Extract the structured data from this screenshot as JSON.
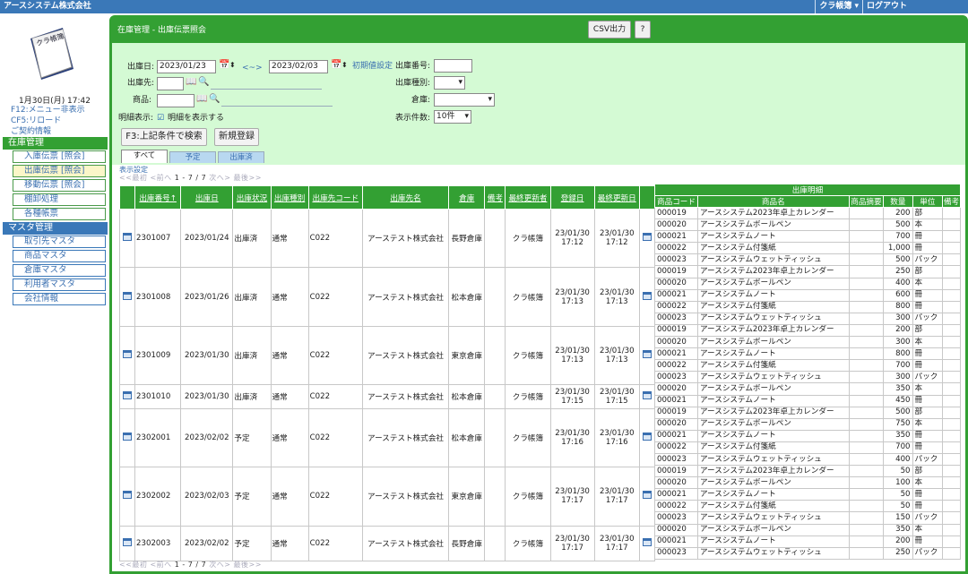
{
  "topbar": {
    "company": "アースシステム株式会社",
    "user_menu": "クラ帳簿 ▾",
    "logout": "ログアウト"
  },
  "sidebar": {
    "logo_text": "クラ帳簿",
    "date": "1月30日(月) 17:42",
    "links": [
      "F12:メニュー非表示",
      "CF5:リロード",
      "ご契約情報"
    ],
    "sections": [
      {
        "title": "在庫管理",
        "color": "#33a033",
        "items": [
          "入庫伝票 [照会]",
          "出庫伝票 [照会]",
          "移動伝票 [照会]",
          "棚卸処理",
          "各種帳票"
        ]
      },
      {
        "title": "マスタ管理",
        "color": "#3a78b8",
        "items": [
          "取引先マスタ",
          "商品マスタ",
          "倉庫マスタ",
          "利用者マスタ",
          "会社情報"
        ]
      }
    ]
  },
  "header": {
    "title": "在庫管理 - 出庫伝票照会",
    "csv_button": "CSV出力",
    "help_button": "?"
  },
  "search": {
    "ship_date_label": "出庫日:",
    "date_from": "2023/01/23",
    "range_sep": "<~>",
    "date_to": "2023/02/03",
    "reset_link": "初期値設定",
    "dest_label": "出庫先:",
    "product_label": "商品:",
    "detail_label": "明細表示:",
    "detail_checkbox": "明細を表示する",
    "ship_no_label": "出庫番号:",
    "ship_type_label": "出庫種別:",
    "warehouse_label": "倉庫:",
    "count_label": "表示件数:",
    "count_value": "10件",
    "search_button": "F3:上記条件で検索",
    "new_button": "新規登録"
  },
  "tabs": [
    "すべて",
    "予定",
    "出庫済"
  ],
  "settings_link": "表示設定",
  "pager": {
    "first": "<<最初",
    "prev": "<前へ",
    "range": "1 - 7 / 7",
    "next": "次へ>",
    "last": "最後>>"
  },
  "grid": {
    "headers": [
      "出庫番号↑",
      "出庫日",
      "出庫状況",
      "出庫種別",
      "出庫先コード",
      "出庫先名",
      "倉庫",
      "備考",
      "最終更新者",
      "登録日",
      "最終更新日"
    ],
    "rows": [
      {
        "no": "2301007",
        "date": "2023/01/24",
        "status": "出庫済",
        "type": "通常",
        "code": "C022",
        "name": "アーステスト株式会社",
        "wh": "長野倉庫",
        "note": "",
        "user": "クラ帳簿",
        "reg": [
          "23/01/30",
          "17:12"
        ],
        "upd": [
          "23/01/30",
          "17:12"
        ],
        "details": [
          [
            "000019",
            "アースシステム2023年卓上カレンダー",
            "",
            "200",
            "部",
            ""
          ],
          [
            "000020",
            "アースシステムボールペン",
            "",
            "500",
            "本",
            ""
          ],
          [
            "000021",
            "アースシステムノート",
            "",
            "700",
            "冊",
            ""
          ],
          [
            "000022",
            "アースシステム付箋紙",
            "",
            "1,000",
            "冊",
            ""
          ],
          [
            "000023",
            "アースシステムウェットティッシュ",
            "",
            "500",
            "パック",
            ""
          ]
        ]
      },
      {
        "no": "2301008",
        "date": "2023/01/26",
        "status": "出庫済",
        "type": "通常",
        "code": "C022",
        "name": "アーステスト株式会社",
        "wh": "松本倉庫",
        "note": "",
        "user": "クラ帳簿",
        "reg": [
          "23/01/30",
          "17:13"
        ],
        "upd": [
          "23/01/30",
          "17:13"
        ],
        "details": [
          [
            "000019",
            "アースシステム2023年卓上カレンダー",
            "",
            "250",
            "部",
            ""
          ],
          [
            "000020",
            "アースシステムボールペン",
            "",
            "400",
            "本",
            ""
          ],
          [
            "000021",
            "アースシステムノート",
            "",
            "600",
            "冊",
            ""
          ],
          [
            "000022",
            "アースシステム付箋紙",
            "",
            "800",
            "冊",
            ""
          ],
          [
            "000023",
            "アースシステムウェットティッシュ",
            "",
            "300",
            "パック",
            ""
          ]
        ]
      },
      {
        "no": "2301009",
        "date": "2023/01/30",
        "status": "出庫済",
        "type": "通常",
        "code": "C022",
        "name": "アーステスト株式会社",
        "wh": "東京倉庫",
        "note": "",
        "user": "クラ帳簿",
        "reg": [
          "23/01/30",
          "17:13"
        ],
        "upd": [
          "23/01/30",
          "17:13"
        ],
        "details": [
          [
            "000019",
            "アースシステム2023年卓上カレンダー",
            "",
            "200",
            "部",
            ""
          ],
          [
            "000020",
            "アースシステムボールペン",
            "",
            "300",
            "本",
            ""
          ],
          [
            "000021",
            "アースシステムノート",
            "",
            "800",
            "冊",
            ""
          ],
          [
            "000022",
            "アースシステム付箋紙",
            "",
            "700",
            "冊",
            ""
          ],
          [
            "000023",
            "アースシステムウェットティッシュ",
            "",
            "300",
            "パック",
            ""
          ]
        ]
      },
      {
        "no": "2301010",
        "date": "2023/01/30",
        "status": "出庫済",
        "type": "通常",
        "code": "C022",
        "name": "アーステスト株式会社",
        "wh": "松本倉庫",
        "note": "",
        "user": "クラ帳簿",
        "reg": [
          "23/01/30",
          "17:15"
        ],
        "upd": [
          "23/01/30",
          "17:15"
        ],
        "details": [
          [
            "000020",
            "アースシステムボールペン",
            "",
            "350",
            "本",
            ""
          ],
          [
            "000021",
            "アースシステムノート",
            "",
            "450",
            "冊",
            ""
          ]
        ]
      },
      {
        "no": "2302001",
        "date": "2023/02/02",
        "status": "予定",
        "type": "通常",
        "code": "C022",
        "name": "アーステスト株式会社",
        "wh": "松本倉庫",
        "note": "",
        "user": "クラ帳簿",
        "reg": [
          "23/01/30",
          "17:16"
        ],
        "upd": [
          "23/01/30",
          "17:16"
        ],
        "details": [
          [
            "000019",
            "アースシステム2023年卓上カレンダー",
            "",
            "500",
            "部",
            ""
          ],
          [
            "000020",
            "アースシステムボールペン",
            "",
            "750",
            "本",
            ""
          ],
          [
            "000021",
            "アースシステムノート",
            "",
            "350",
            "冊",
            ""
          ],
          [
            "000022",
            "アースシステム付箋紙",
            "",
            "700",
            "冊",
            ""
          ],
          [
            "000023",
            "アースシステムウェットティッシュ",
            "",
            "400",
            "パック",
            ""
          ]
        ]
      },
      {
        "no": "2302002",
        "date": "2023/02/03",
        "status": "予定",
        "type": "通常",
        "code": "C022",
        "name": "アーステスト株式会社",
        "wh": "東京倉庫",
        "note": "",
        "user": "クラ帳簿",
        "reg": [
          "23/01/30",
          "17:17"
        ],
        "upd": [
          "23/01/30",
          "17:17"
        ],
        "details": [
          [
            "000019",
            "アースシステム2023年卓上カレンダー",
            "",
            "50",
            "部",
            ""
          ],
          [
            "000020",
            "アースシステムボールペン",
            "",
            "100",
            "本",
            ""
          ],
          [
            "000021",
            "アースシステムノート",
            "",
            "50",
            "冊",
            ""
          ],
          [
            "000022",
            "アースシステム付箋紙",
            "",
            "50",
            "冊",
            ""
          ],
          [
            "000023",
            "アースシステムウェットティッシュ",
            "",
            "150",
            "パック",
            ""
          ]
        ]
      },
      {
        "no": "2302003",
        "date": "2023/02/02",
        "status": "予定",
        "type": "通常",
        "code": "C022",
        "name": "アーステスト株式会社",
        "wh": "長野倉庫",
        "note": "",
        "user": "クラ帳簿",
        "reg": [
          "23/01/30",
          "17:17"
        ],
        "upd": [
          "23/01/30",
          "17:17"
        ],
        "details": [
          [
            "000020",
            "アースシステムボールペン",
            "",
            "350",
            "本",
            ""
          ],
          [
            "000021",
            "アースシステムノート",
            "",
            "200",
            "冊",
            ""
          ],
          [
            "000023",
            "アースシステムウェットティッシュ",
            "",
            "250",
            "パック",
            ""
          ]
        ]
      }
    ]
  },
  "detail": {
    "title": "出庫明細",
    "headers": [
      "商品コード",
      "商品名",
      "商品摘要",
      "数量",
      "単位",
      "備考"
    ]
  },
  "colors": {
    "green": "#33a033",
    "blue": "#3a78b8",
    "search_bg": "#d4fad4"
  }
}
